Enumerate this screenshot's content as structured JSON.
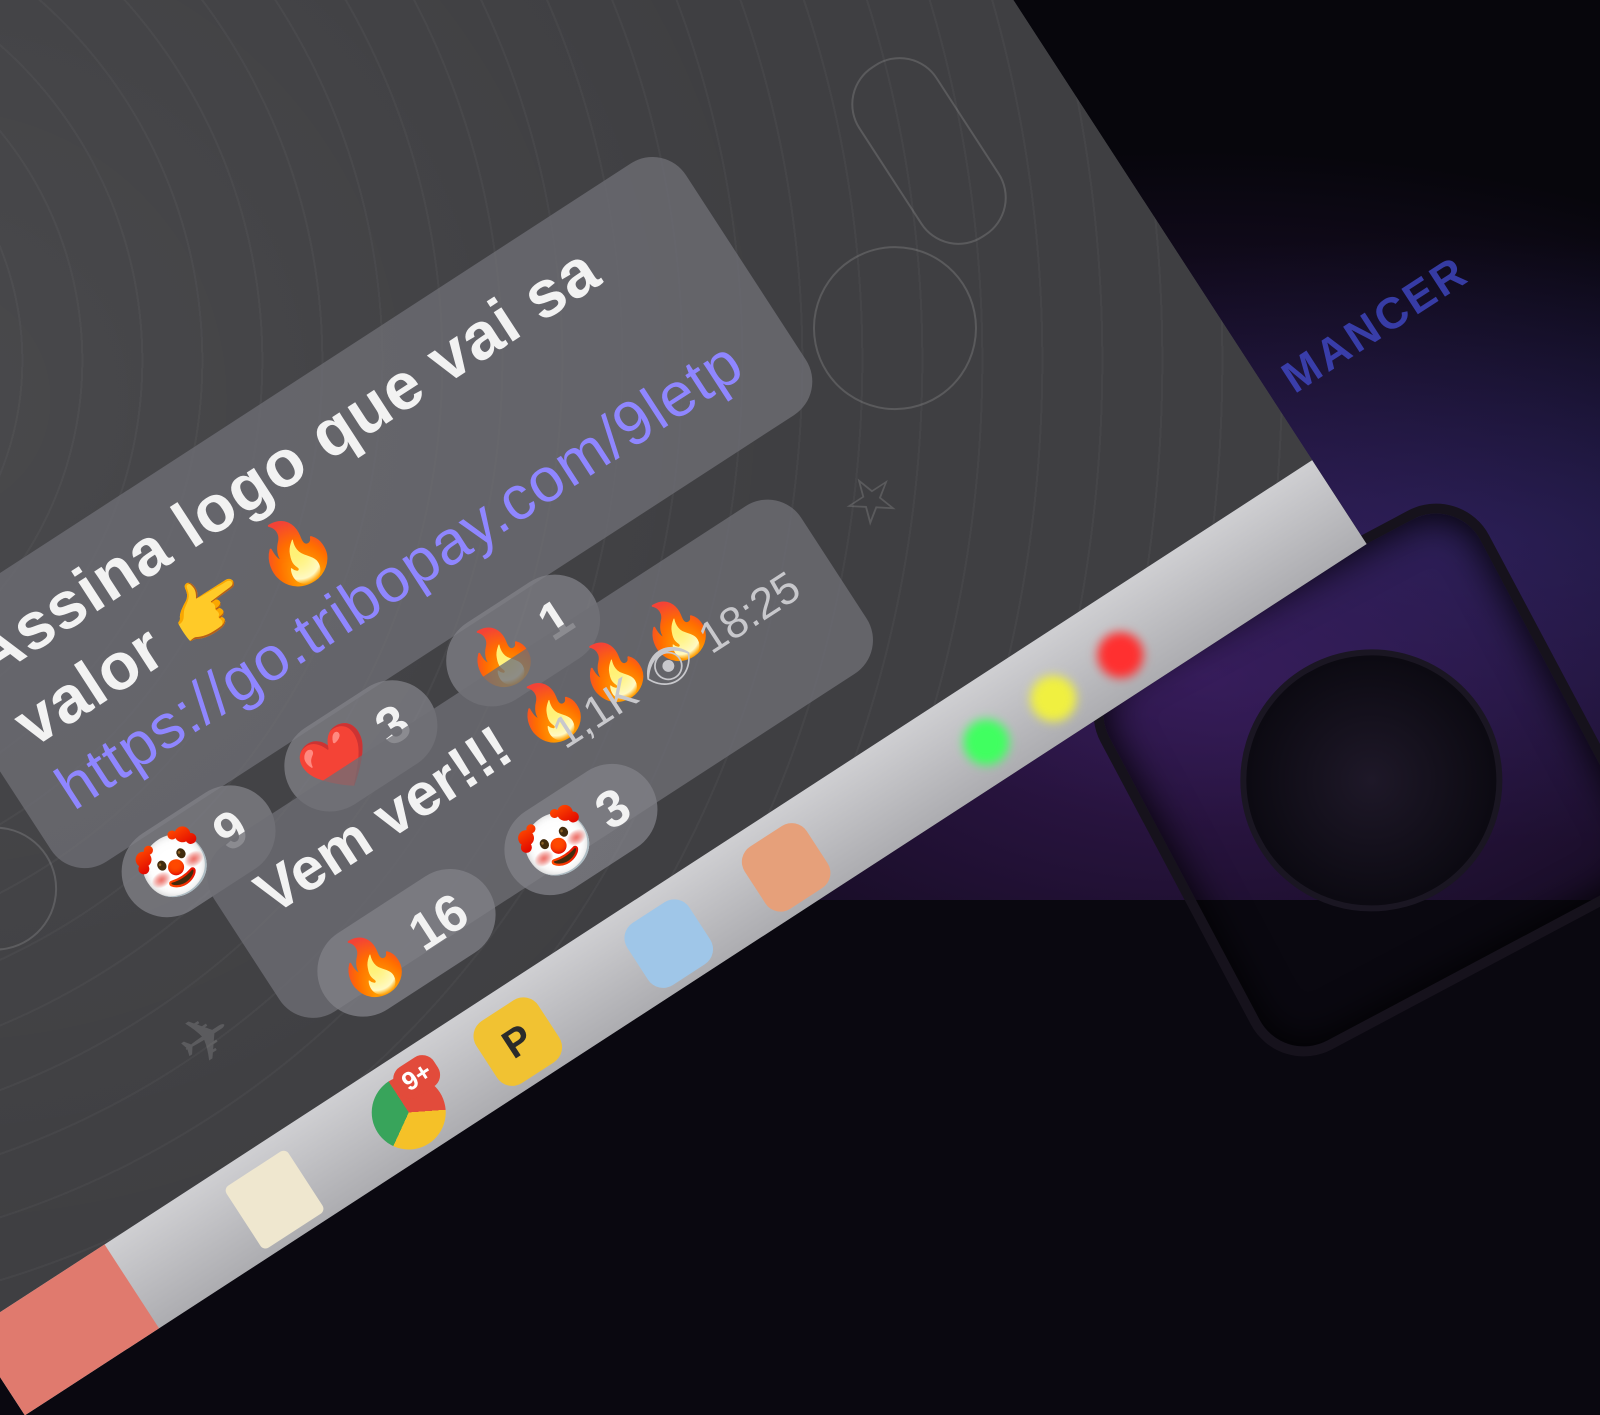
{
  "background_counter": "1",
  "message1": {
    "line1": "Assina logo que vai sa",
    "emoji1": "🔥",
    "line2": "valor",
    "emoji2": "👉",
    "link": "https://go.tribopay.com/9letp",
    "reactions": [
      {
        "emoji": "🤡",
        "count": "9"
      },
      {
        "emoji": "❤️",
        "count": "3"
      },
      {
        "emoji": "🔥",
        "count": "1"
      }
    ]
  },
  "message2": {
    "text": "Vem ver!!! 🔥🔥🔥",
    "views": "1,1K",
    "time": "18:25",
    "reactions": [
      {
        "emoji": "🔥",
        "count": "16"
      },
      {
        "emoji": "🤡",
        "count": "3"
      }
    ]
  },
  "taskbar": {
    "chrome_badge": "9+",
    "coin_label": "P"
  },
  "brand_text": "MANCER",
  "colors": {
    "link": "#8f86ff",
    "bubble": "#6e6e74",
    "reaction_chip": "#828288",
    "start_button": "#e07a6e"
  }
}
